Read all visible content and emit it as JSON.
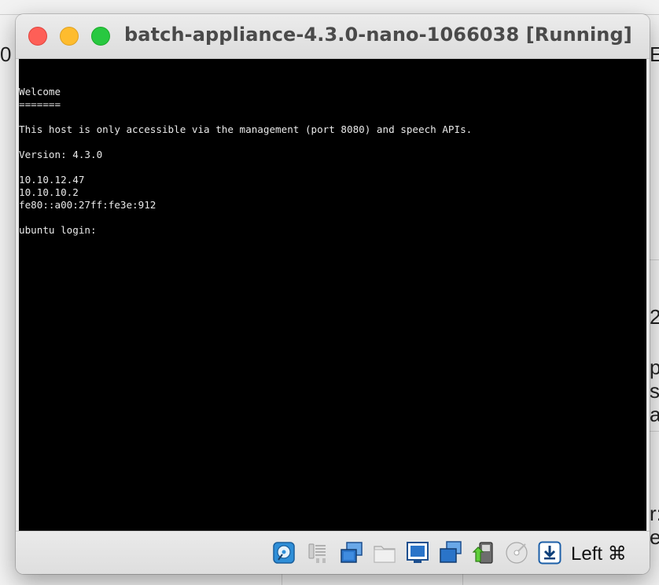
{
  "window": {
    "title": "batch-appliance-4.3.0-nano-1066038 [Running]"
  },
  "console": {
    "lines": [
      "Welcome",
      "=======",
      "",
      "This host is only accessible via the management (port 8080) and speech APIs.",
      "",
      "Version: 4.3.0",
      "",
      "10.10.12.47",
      "10.10.10.2",
      "fe80::a00:27ff:fe3e:912",
      "",
      "ubuntu login:"
    ]
  },
  "statusbar": {
    "host_key": "Left ⌘",
    "icons": [
      "hard-disk-icon",
      "audio-icon",
      "network-icon",
      "shared-folder-icon",
      "display-icon",
      "display-alt-icon",
      "usb-icon",
      "optical-disk-icon",
      "host-key-arrow-icon"
    ]
  },
  "background": {
    "left_char": "0",
    "right_chars": [
      "E",
      "2",
      "p",
      "s",
      "a",
      "r:",
      "e"
    ]
  },
  "colors": {
    "close": "#fe5f57",
    "minimize": "#febc2e",
    "maximize": "#28c840",
    "console_bg": "#000000",
    "console_fg": "#e9e9e9"
  }
}
